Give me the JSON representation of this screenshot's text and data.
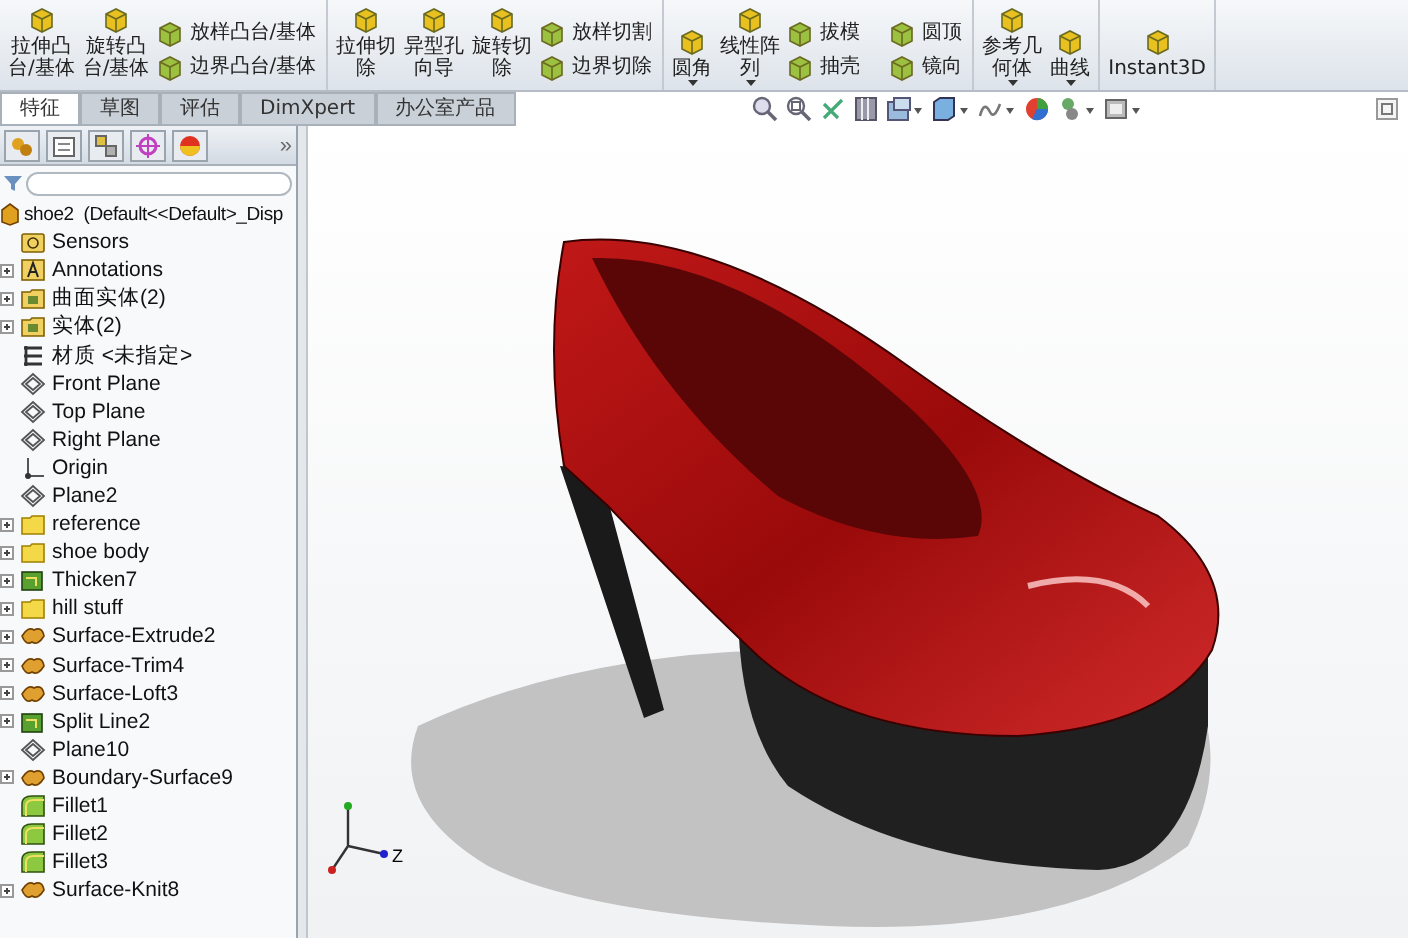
{
  "ribbon": {
    "groups": [
      {
        "items": [
          {
            "kind": "large",
            "lines": [
              "拉伸凸",
              "台/基体"
            ],
            "dropdown": false
          },
          {
            "kind": "large",
            "lines": [
              "旋转凸",
              "台/基体"
            ],
            "dropdown": false
          },
          {
            "kind": "stack",
            "items": [
              {
                "label": "放样凸台/基体"
              },
              {
                "label": "边界凸台/基体"
              }
            ]
          }
        ]
      },
      {
        "items": [
          {
            "kind": "large",
            "lines": [
              "拉伸切",
              "除"
            ],
            "dropdown": false
          },
          {
            "kind": "large",
            "lines": [
              "异型孔",
              "向导"
            ],
            "dropdown": false
          },
          {
            "kind": "large",
            "lines": [
              "旋转切",
              "除"
            ],
            "dropdown": false
          },
          {
            "kind": "stack",
            "items": [
              {
                "label": "放样切割"
              },
              {
                "label": "边界切除"
              }
            ]
          }
        ]
      },
      {
        "items": [
          {
            "kind": "large",
            "lines": [
              "圆角"
            ],
            "dropdown": true
          },
          {
            "kind": "large",
            "lines": [
              "线性阵",
              "列"
            ],
            "dropdown": true
          },
          {
            "kind": "stack",
            "items": [
              {
                "label": "拔模"
              },
              {
                "label": "抽壳"
              }
            ]
          },
          {
            "kind": "stack",
            "items": [
              {
                "label": "圆顶"
              },
              {
                "label": "镜向"
              }
            ]
          }
        ]
      },
      {
        "items": [
          {
            "kind": "large",
            "lines": [
              "参考几",
              "何体"
            ],
            "dropdown": true
          },
          {
            "kind": "large",
            "lines": [
              "曲线"
            ],
            "dropdown": true
          }
        ]
      },
      {
        "items": [
          {
            "kind": "large",
            "lines": [
              "Instant3D"
            ],
            "dropdown": false
          }
        ]
      }
    ]
  },
  "tabs": [
    {
      "label": "特征",
      "selected": true
    },
    {
      "label": "草图",
      "selected": false
    },
    {
      "label": "评估",
      "selected": false
    },
    {
      "label": "DimXpert",
      "selected": false
    },
    {
      "label": "办公室产品",
      "selected": false
    }
  ],
  "panel": {
    "overflow_glyph": "»",
    "tree": {
      "label": "shoe2  (Default<<Default>_Disp",
      "kind": "part",
      "children": [
        {
          "label": "Sensors",
          "kind": "sensors",
          "expandable": false
        },
        {
          "label": "Annotations",
          "kind": "annotations",
          "expandable": true
        },
        {
          "label": "曲面实体(2)",
          "kind": "bodies",
          "expandable": true
        },
        {
          "label": "实体(2)",
          "kind": "bodies",
          "expandable": true
        },
        {
          "label": "材质 <未指定>",
          "kind": "material",
          "expandable": false
        },
        {
          "label": "Front Plane",
          "kind": "plane",
          "expandable": false
        },
        {
          "label": "Top Plane",
          "kind": "plane",
          "expandable": false
        },
        {
          "label": "Right Plane",
          "kind": "plane",
          "expandable": false
        },
        {
          "label": "Origin",
          "kind": "origin",
          "expandable": false
        },
        {
          "label": "Plane2",
          "kind": "plane",
          "expandable": false
        },
        {
          "label": "reference",
          "kind": "folder",
          "expandable": true
        },
        {
          "label": "shoe body",
          "kind": "folder",
          "expandable": true
        },
        {
          "label": "Thicken7",
          "kind": "feature",
          "expandable": true
        },
        {
          "label": "hill stuff",
          "kind": "folder",
          "expandable": true
        },
        {
          "label": "Surface-Extrude2",
          "kind": "surface",
          "expandable": true
        },
        {
          "label": "Surface-Trim4",
          "kind": "surface",
          "expandable": true
        },
        {
          "label": "Surface-Loft3",
          "kind": "surface",
          "expandable": true
        },
        {
          "label": "Split Line2",
          "kind": "feature",
          "expandable": true
        },
        {
          "label": "Plane10",
          "kind": "plane",
          "expandable": false
        },
        {
          "label": "Boundary-Surface9",
          "kind": "surface",
          "expandable": true
        },
        {
          "label": "Fillet1",
          "kind": "fillet",
          "expandable": false
        },
        {
          "label": "Fillet2",
          "kind": "fillet",
          "expandable": false
        },
        {
          "label": "Fillet3",
          "kind": "fillet",
          "expandable": false
        },
        {
          "label": "Surface-Knit8",
          "kind": "surface",
          "expandable": true
        }
      ]
    }
  },
  "viewport": {
    "triad_label": "Z"
  }
}
